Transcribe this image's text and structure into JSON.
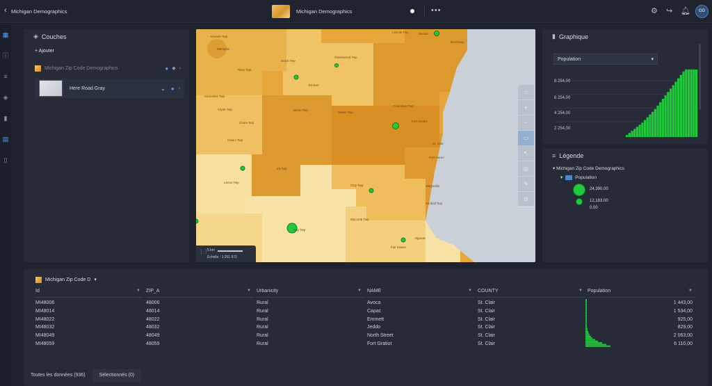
{
  "app": {
    "title": "Michigan Demographics",
    "map_title": "Michigan Demographics"
  },
  "icons": {
    "back": "chevron-left-icon",
    "more": "more-icon",
    "settings": "gear-icon",
    "share": "share-icon",
    "notifications": "bell-icon",
    "avatar": "avatar"
  },
  "topbar": {
    "avatar_initials": "GG"
  },
  "layers_panel": {
    "title": "Couches",
    "add_label": "Ajouter",
    "layers": [
      {
        "name": "Michigan Zip Code Demographics"
      },
      {
        "name": "Here Road Gray"
      }
    ]
  },
  "map": {
    "labels": [
      "Lincoln Twp",
      "Sanilac",
      "Greenwood Twp",
      "Grant Twp",
      "Brockway",
      "Riley Twp",
      "Emmet",
      "Berlin Twp",
      "Kenockee Twp",
      "Wales Twp",
      "Fort Gratiot",
      "Clyde Twp",
      "Casco Twp",
      "Columbus Twp",
      "China Twp",
      "St. Clair",
      "Ira Twp",
      "Clay Twp",
      "Marysville",
      "Lenox Twp",
      "Algonac",
      "Fair Haven",
      "Macomb Twp",
      "Ray Twp",
      "Armada Twp",
      "Memphis",
      "Port Huron",
      "Kimball Twp"
    ],
    "scale_distance": "5 km",
    "scale_ratio_label": "Échelle : 1:251 572"
  },
  "chart_panel": {
    "title": "Graphique",
    "field_selected": "Population",
    "y_ticks": [
      "8 254,00",
      "6 254,00",
      "4 254,00",
      "2 254,00"
    ]
  },
  "chart_data": {
    "type": "bar",
    "series": [
      {
        "name": "Population",
        "values": [
          300,
          600,
          900,
          1200,
          1500,
          1800,
          2100,
          2500,
          2900,
          3300,
          3700,
          4100,
          4600,
          5100,
          5600,
          6100,
          6600,
          7100,
          7600,
          8100,
          8600,
          9100,
          9600,
          9900,
          9900,
          9900,
          9900,
          9900
        ]
      }
    ],
    "ylim": [
      0,
      10500
    ],
    "y_ticks": [
      2254,
      4254,
      6254,
      8254
    ],
    "grid": true,
    "color": "#1fc83a"
  },
  "legend_panel": {
    "title": "Légende",
    "layer": "Michigan Zip Code Demographics",
    "field": "Population",
    "entries": [
      "24,390.00",
      "12,183.00",
      "0.00"
    ]
  },
  "table": {
    "layer_selector": "Michigan Zip Code D",
    "columns": [
      "Id",
      "ZIP_A",
      "Urbanicity",
      "NAME",
      "COUNTY",
      "Population"
    ],
    "rows": [
      [
        "MI48006",
        "48006",
        "Rural",
        "Avoca",
        "St. Clair",
        "1 443,00"
      ],
      [
        "MI48014",
        "48014",
        "Rural",
        "Capac",
        "St. Clair",
        "1 534,00"
      ],
      [
        "MI48022",
        "48022",
        "Rural",
        "Emmett",
        "St. Clair",
        "925,00"
      ],
      [
        "MI48032",
        "48032",
        "Rural",
        "Jeddo",
        "St. Clair",
        "829,00"
      ],
      [
        "MI48049",
        "48049",
        "Rural",
        "North Street",
        "St. Clair",
        "2 063,00"
      ],
      [
        "MI48059",
        "48059",
        "Rural",
        "Fort Gratiot",
        "St. Clair",
        "6 110,00"
      ]
    ],
    "tabs": [
      "Toutes les données (936)",
      "Sélectionnés (0)"
    ]
  }
}
